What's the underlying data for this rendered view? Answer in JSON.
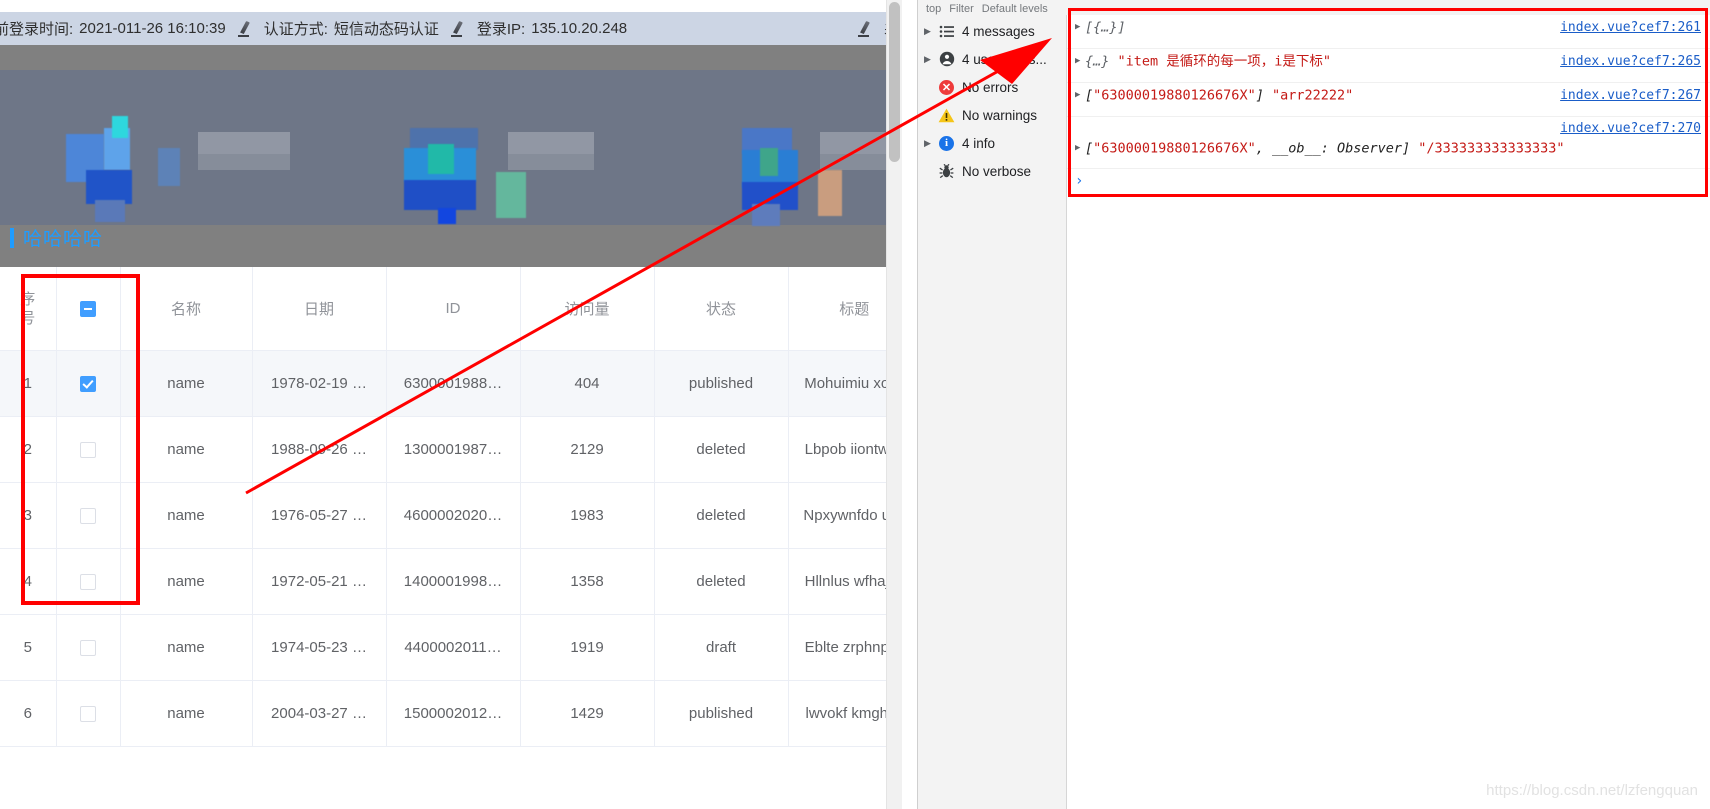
{
  "page": {
    "info_bar": {
      "login_time_label": "前登录时间:",
      "login_time_value": "2021-011-26 16:10:39",
      "auth_label": "认证方式:",
      "auth_value": "短信动态码认证",
      "ip_label": "登录IP:",
      "ip_value": "135.10.20.248",
      "trailing_clipped": "表"
    },
    "hero": {
      "title": "哈哈哈哈"
    },
    "table": {
      "columns": [
        "序号",
        "",
        "名称",
        "日期",
        "ID",
        "访问量",
        "状态",
        "标题"
      ],
      "seq_header_line1": "序",
      "seq_header_line2": "号",
      "header_checkbox_state": "indeterminate",
      "rows": [
        {
          "seq": "1",
          "checked": true,
          "name": "name",
          "date": "1978-02-19 …",
          "id": "6300001988…",
          "views": "404",
          "status": "published",
          "title": "Mohuimiu xo…"
        },
        {
          "seq": "2",
          "checked": false,
          "name": "name",
          "date": "1988-09-26 …",
          "id": "1300001987…",
          "views": "2129",
          "status": "deleted",
          "title": "Lbpob iiontw…"
        },
        {
          "seq": "3",
          "checked": false,
          "name": "name",
          "date": "1976-05-27 …",
          "id": "4600002020…",
          "views": "1983",
          "status": "deleted",
          "title": "Npxywnfdo u…"
        },
        {
          "seq": "4",
          "checked": false,
          "name": "name",
          "date": "1972-05-21 …",
          "id": "1400001998…",
          "views": "1358",
          "status": "deleted",
          "title": "Hllnlus wfhaj…"
        },
        {
          "seq": "5",
          "checked": false,
          "name": "name",
          "date": "1974-05-23 …",
          "id": "4400002011…",
          "views": "1919",
          "status": "draft",
          "title": "Eblte zrphnp…"
        },
        {
          "seq": "6",
          "checked": false,
          "name": "name",
          "date": "2004-03-27 …",
          "id": "1500002012…",
          "views": "1429",
          "status": "published",
          "title": "lwvokf kmgh…"
        }
      ]
    }
  },
  "devtools": {
    "toolbar": {
      "context_label": "top",
      "filter_placeholder": "Filter",
      "levels_label": "Default levels"
    },
    "sidebar": [
      {
        "label": "4 messages",
        "icon": "list-icon",
        "expandable": true
      },
      {
        "label": "4 user mess...",
        "icon": "person-icon",
        "expandable": true
      },
      {
        "label": "No errors",
        "icon": "error-icon",
        "expandable": false
      },
      {
        "label": "No warnings",
        "icon": "warning-icon",
        "expandable": false
      },
      {
        "label": "4 info",
        "icon": "info-icon",
        "expandable": true
      },
      {
        "label": "No verbose",
        "icon": "bug-icon",
        "expandable": false
      }
    ],
    "console_rows": [
      {
        "parts": [
          {
            "text": "[{…}]",
            "style": "gray"
          }
        ],
        "source": "index.vue?cef7:261"
      },
      {
        "parts": [
          {
            "text": "{…} ",
            "style": "gray"
          },
          {
            "text": "\"item 是循环的每一项，i是下标\"",
            "style": "red"
          }
        ],
        "source": "index.vue?cef7:265"
      },
      {
        "parts": [
          {
            "text": "[",
            "style": "dark"
          },
          {
            "text": "\"63000019880126676X\"",
            "style": "red"
          },
          {
            "text": "] ",
            "style": "dark"
          },
          {
            "text": "\"arr22222\"",
            "style": "red"
          }
        ],
        "source": "index.vue?cef7:267"
      },
      {
        "parts": [
          {
            "text": "[",
            "style": "dark"
          },
          {
            "text": "\"63000019880126676X\"",
            "style": "red"
          },
          {
            "text": ", __ob__: Observer] ",
            "style": "dark"
          },
          {
            "text": "\"/333333333333333\"",
            "style": "red"
          }
        ],
        "source": "index.vue?cef7:270"
      }
    ],
    "prompt": "›"
  },
  "watermark": "https://blog.csdn.net/lzfengquan",
  "colors": {
    "accent_blue": "#409eff",
    "annotation_red": "#ff0000",
    "info_bar_bg": "#ccd5e4",
    "hero_bg": "#808080",
    "console_string_red": "#c41a16",
    "console_link_blue": "#1a5dc8"
  }
}
